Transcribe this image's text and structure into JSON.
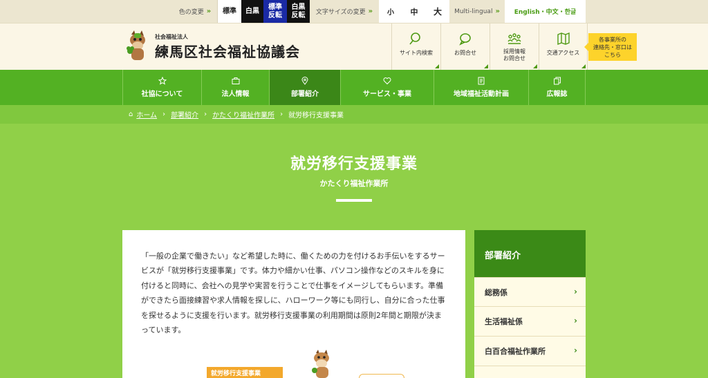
{
  "utility": {
    "color_label": "色の変更",
    "color_std": "標準",
    "color_wb": "白黒",
    "color_nr": [
      "標準",
      "反転"
    ],
    "color_wbr": [
      "白黒",
      "反転"
    ],
    "size_label": "文字サイズの変更",
    "size_s": "小",
    "size_m": "中",
    "size_l": "大",
    "multi": "Multi-lingual",
    "lang": "English・中文・한글"
  },
  "header": {
    "org_sub": "社会福祉法人",
    "org_name": "練馬区社会福祉協議会",
    "buttons": [
      {
        "label": "サイト内検索",
        "icon": "search-icon"
      },
      {
        "label": "お問合せ",
        "icon": "chat-icon"
      },
      {
        "label": "採用情報お問合せ",
        "line1": "採用情報",
        "line2": "お問合せ",
        "icon": "people-icon"
      },
      {
        "label": "交通アクセス",
        "icon": "map-icon"
      }
    ],
    "contact": [
      "各事業所の",
      "連絡先・窓口は",
      "こちら"
    ]
  },
  "nav": [
    {
      "label": "社協について",
      "icon": "star-icon"
    },
    {
      "label": "法人情報",
      "icon": "briefcase-icon"
    },
    {
      "label": "部署紹介",
      "icon": "pin-icon"
    },
    {
      "label": "サービス・事業",
      "icon": "heart-icon"
    },
    {
      "label": "地域福祉活動計画",
      "icon": "document-icon"
    },
    {
      "label": "広報誌",
      "icon": "copy-icon"
    }
  ],
  "breadcrumb": {
    "home": "ホーム",
    "items": [
      "部署紹介",
      "かたくり福祉作業所"
    ],
    "current": "就労移行支援事業"
  },
  "hero": {
    "title": "就労移行支援事業",
    "subtitle": "かたくり福祉作業所"
  },
  "content": {
    "body": "「一般の企業で働きたい」など希望した時に、働くための力を付けるお手伝いをするサービスが「就労移行支援事業」です。体力や細かい仕事、パソコン操作などのスキルを身に付けると同時に、会社への見学や実習を行うことで仕事をイメージしてもらいます。準備ができたら面接練習や求人情報を探しに、ハローワーク等にも同行し、自分に合った仕事を探せるように支援を行います。就労移行支援事業の利用期間は原則2年間と期限が決まっています。",
    "poster_text": "就労移行支援事業"
  },
  "sidebar": {
    "title": "部署紹介",
    "items": [
      "総務係",
      "生活福祉係",
      "白百合福祉作業所"
    ]
  },
  "colors": {
    "nav_green": "#53b123",
    "nav_active": "#3b8718",
    "hero_green": "#90d048",
    "contact_yellow": "#fdd32b"
  }
}
